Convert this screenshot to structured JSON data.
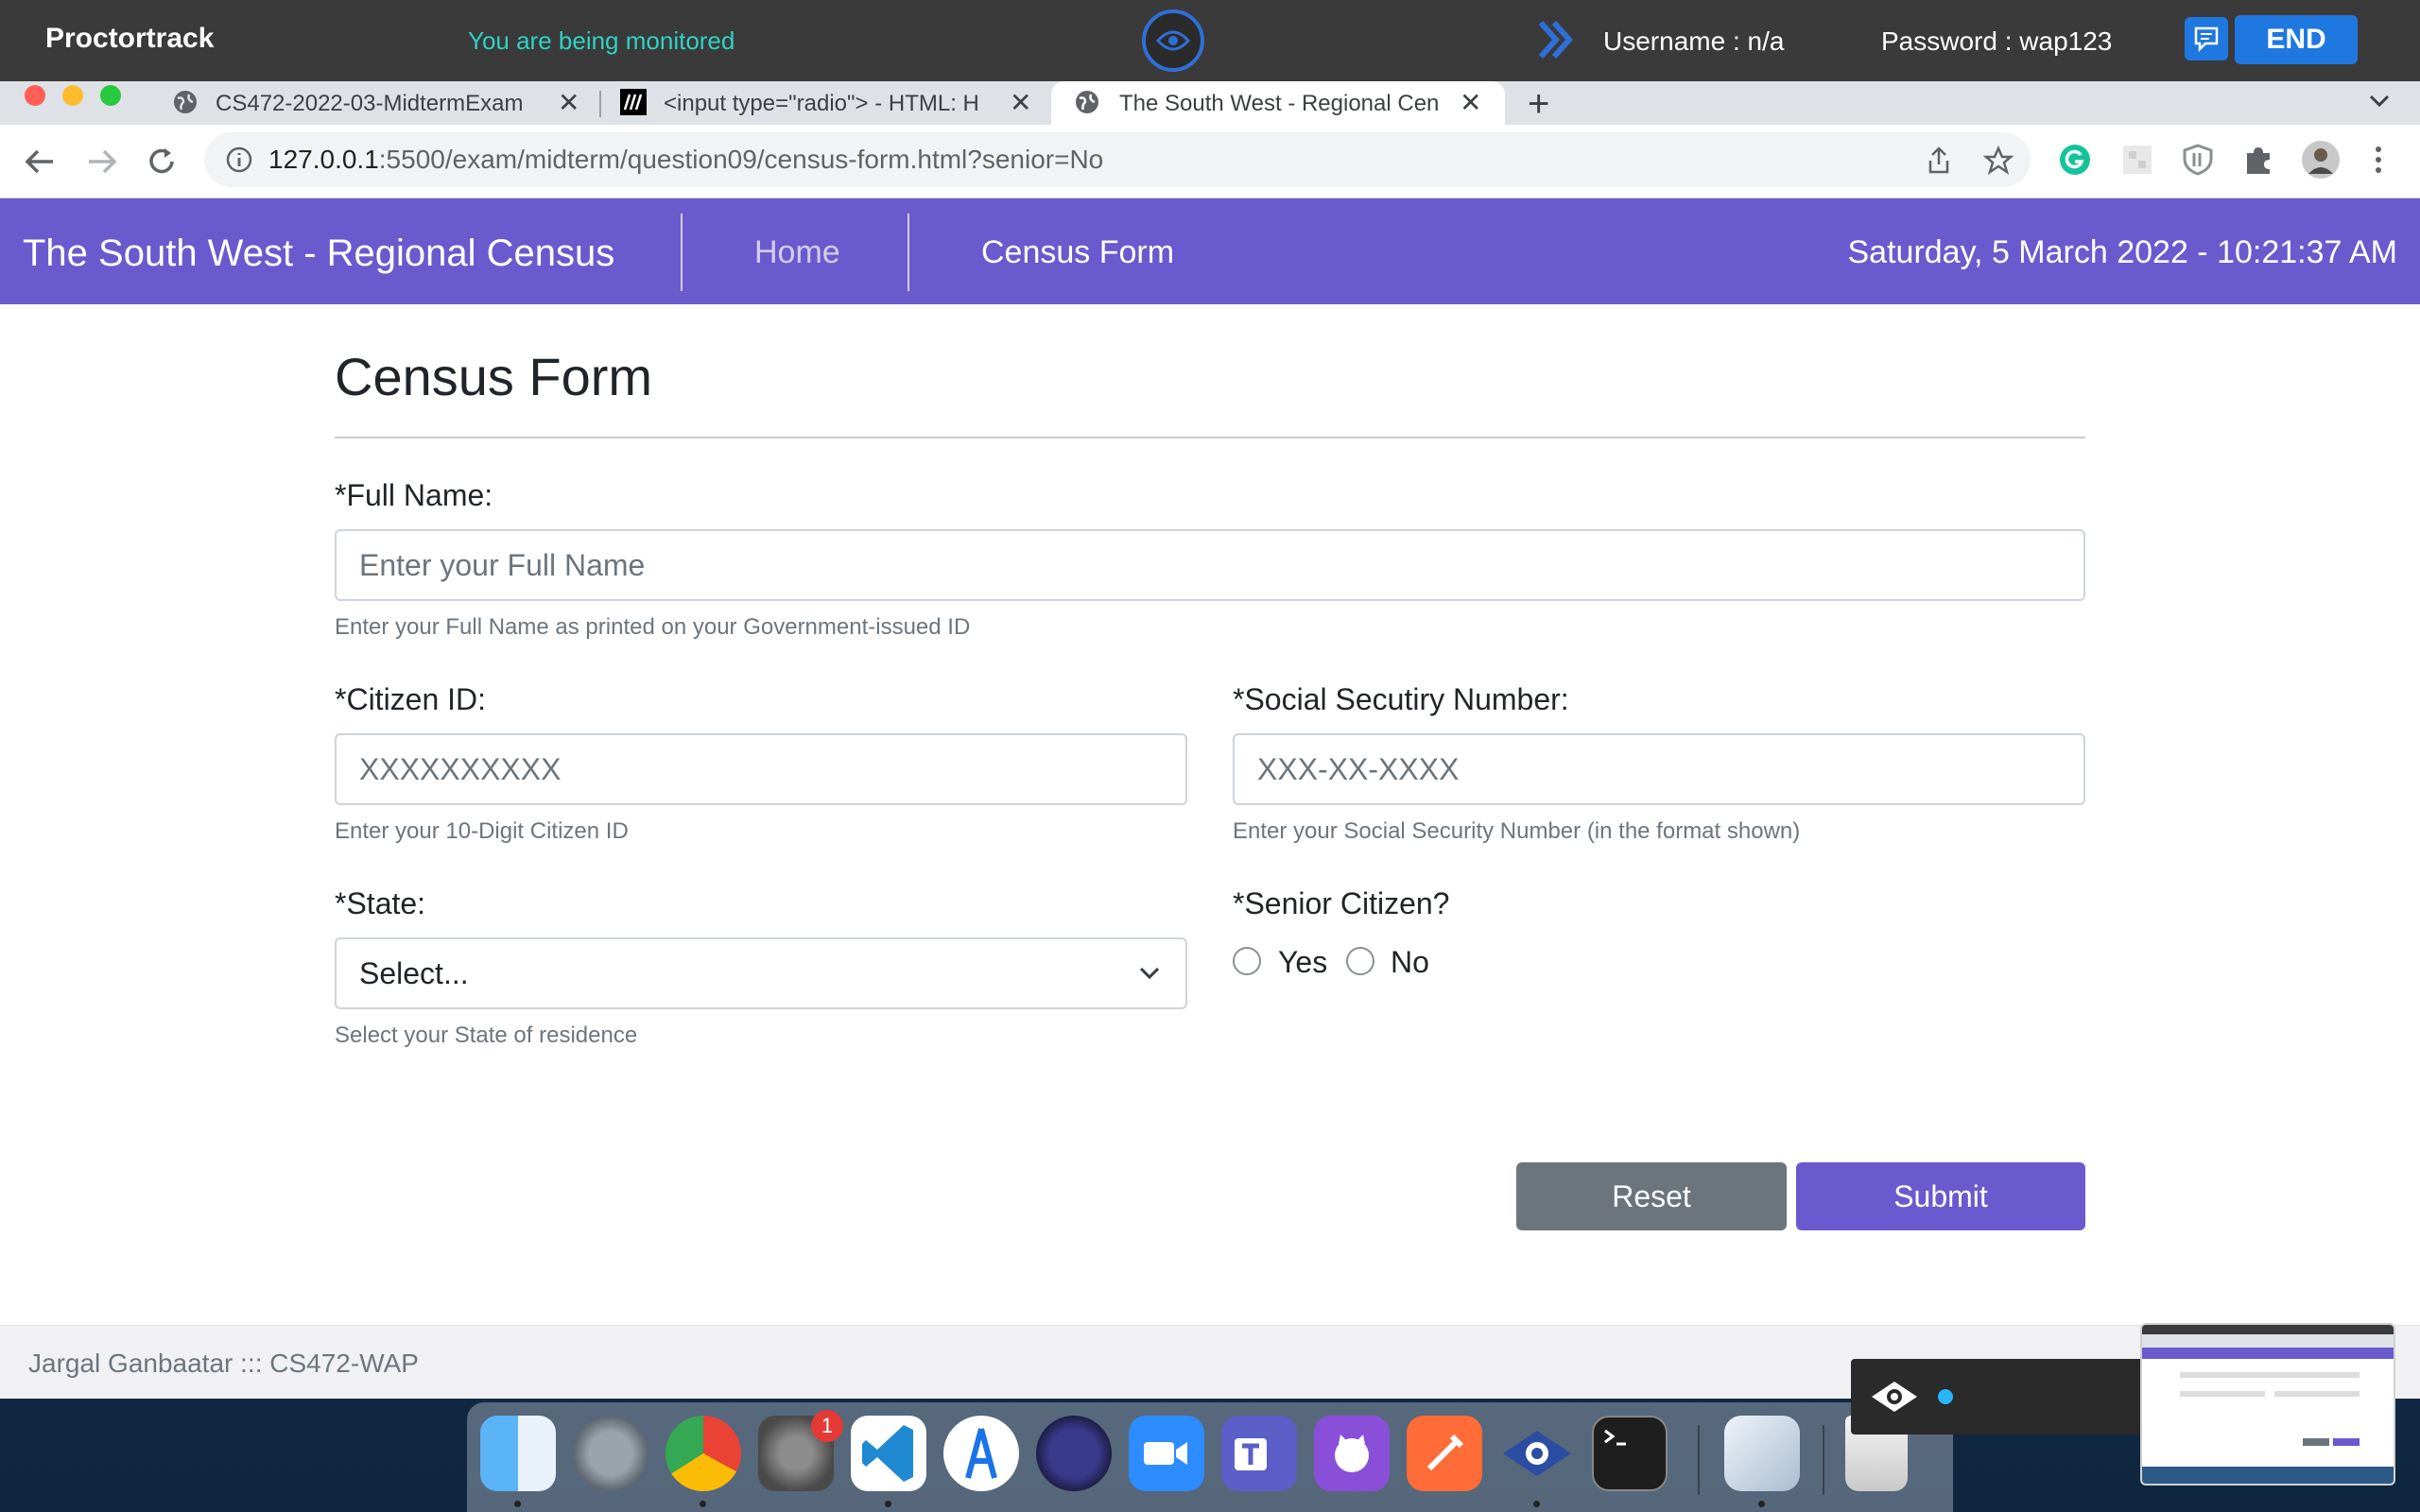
{
  "proctor": {
    "brand": "Proctortrack",
    "monitored": "You are being monitored",
    "username": "Username : n/a",
    "password": "Password : wap123",
    "end_label": "END"
  },
  "browser": {
    "tabs": [
      {
        "title": "CS472-2022-03-MidtermExam",
        "icon": "globe-icon",
        "active": false
      },
      {
        "title": "<input type=\"radio\"> - HTML: H",
        "icon": "mdn-icon",
        "active": false
      },
      {
        "title": "The South West - Regional Cen",
        "icon": "globe-icon",
        "active": true
      }
    ],
    "url_host": "127.0.0.1",
    "url_rest": ":5500/exam/midterm/question09/census-form.html?senior=No"
  },
  "app": {
    "site_title": "The South West - Regional Census",
    "nav": {
      "home": "Home",
      "form": "Census Form"
    },
    "clock": "Saturday, 5 March 2022 - 10:21:37 AM"
  },
  "form": {
    "title": "Census Form",
    "fullname": {
      "label": "*Full Name:",
      "placeholder": "Enter your Full Name",
      "help": "Enter your Full Name as printed on your Government-issued ID"
    },
    "citizen_id": {
      "label": "*Citizen ID:",
      "placeholder": "XXXXXXXXXX",
      "help": "Enter your 10-Digit Citizen ID"
    },
    "ssn": {
      "label": "*Social Secutiry Number:",
      "placeholder": "XXX-XX-XXXX",
      "help": "Enter your Social Security Number (in the format shown)"
    },
    "state": {
      "label": "*State:",
      "selected": "Select...",
      "help": "Select your State of residence"
    },
    "senior": {
      "label": "*Senior Citizen?",
      "options": [
        "Yes",
        "No"
      ]
    },
    "reset_label": "Reset",
    "submit_label": "Submit"
  },
  "footer": {
    "text": "Jargal Ganbaatar ::: CS472-WAP"
  },
  "dock": {
    "badge_count": "1",
    "apps": [
      "finder-icon",
      "launchpad-icon",
      "chrome-icon",
      "system-preferences-icon",
      "vscode-icon",
      "android-studio-icon",
      "eclipse-icon",
      "zoom-icon",
      "teams-icon",
      "github-desktop-icon",
      "postman-icon",
      "proctortrack-icon",
      "terminal-icon",
      "xcode-icon",
      "trash-icon"
    ]
  },
  "colors": {
    "navbar": "#6a5acd",
    "submit": "#6a5acd",
    "reset": "#6c757d",
    "proctor_bar": "#3a3a3a",
    "monitored": "#2fd3c3",
    "end_button": "#1f78e0"
  }
}
